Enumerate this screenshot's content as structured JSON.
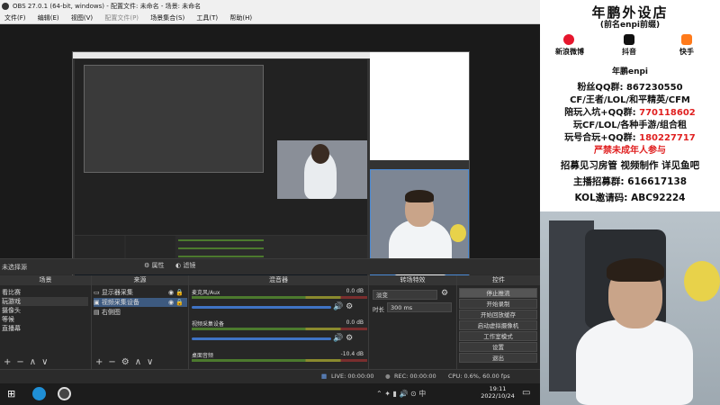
{
  "window": {
    "title": "OBS 27.0.1 (64-bit, windows) - 配置文件: 未命名 - 场景: 未命名"
  },
  "menu": [
    "文件(F)",
    "编辑(E)",
    "视图(V)",
    "配置文件(P)",
    "场景集合(S)",
    "工具(T)",
    "帮助(H)"
  ],
  "scene_bar": {
    "no_source": "未选择源",
    "properties": "属性",
    "filters": "滤镜"
  },
  "docks": {
    "scenes": {
      "title": "场景",
      "items": [
        "看比赛",
        "玩游戏",
        "摄像头",
        "等候",
        "直播幕"
      ]
    },
    "sources": {
      "title": "来源",
      "items": [
        "显示器采集",
        "视频采集设备",
        "右侧图"
      ]
    },
    "mixer": {
      "title": "混音器",
      "channels": [
        {
          "name": "麦克风/Aux",
          "db": "0.0 dB",
          "level": 0.65
        },
        {
          "name": "视频采集设备",
          "db": "0.0 dB",
          "level": 0.5
        },
        {
          "name": "桌面音频",
          "db": "-10.4 dB",
          "level": 0.72
        }
      ]
    },
    "transitions": {
      "title": "转场特效",
      "type": "淡变",
      "duration_label": "时长",
      "duration": "300 ms"
    },
    "controls": {
      "title": "控件",
      "buttons": [
        "停止推流",
        "开始录制",
        "开始回放缓存",
        "启动虚拟摄像机",
        "工作室模式",
        "设置",
        "退出"
      ]
    }
  },
  "status": {
    "live": "LIVE: 00:00:00",
    "rec": "REC: 00:00:00",
    "cpu": "CPU: 0.6%, 60.00 fps"
  },
  "taskbar": {
    "time": "19:11",
    "date": "2022/10/24"
  },
  "banner": {
    "title": "年鹏外设店",
    "subtitle": "(前名enpi前缀)",
    "socials": [
      "新浪微博",
      "抖音",
      "快手"
    ],
    "handle": "年鹏enpi",
    "lines": [
      {
        "label": "粉丝QQ群:",
        "value": "867230550"
      },
      {
        "label": "CF/王者/LOL/和平精英/CFM",
        "value": ""
      },
      {
        "label": "陪玩入坑+QQ群:",
        "value": "770118602"
      },
      {
        "label": "玩CF/LOL/各种手游/组合租",
        "value": ""
      },
      {
        "label": "玩号合玩+QQ群:",
        "value": "180227717"
      },
      {
        "label": "严禁未成年人参与",
        "value": ""
      },
      {
        "label": "招募见习房管 视频制作 详见鱼吧",
        "value": ""
      },
      {
        "label": "主播招募群:",
        "value": "616617138"
      },
      {
        "label": "KOL邀请码:",
        "value": "ABC92224"
      }
    ]
  }
}
